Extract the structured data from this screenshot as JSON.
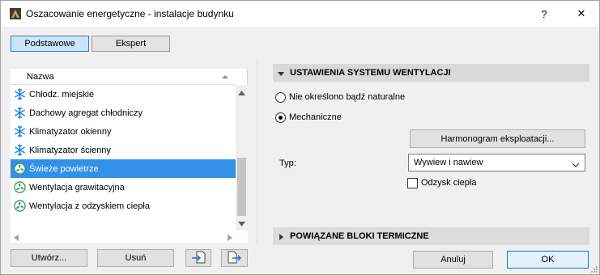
{
  "window": {
    "title": "Oszacowanie energetyczne - instalacje budynku",
    "help_label": "?",
    "close_label": "✕"
  },
  "tabs": [
    {
      "label": "Podstawowe",
      "active": true
    },
    {
      "label": "Ekspert",
      "active": false
    }
  ],
  "list": {
    "header": "Nazwa",
    "items": [
      {
        "label": "Chłodz. miejskie",
        "icon": "snowflake-icon",
        "selected": false
      },
      {
        "label": "Dachowy agregat chłodniczy",
        "icon": "snowflake-icon",
        "selected": false
      },
      {
        "label": "Klimatyzator okienny",
        "icon": "snowflake-icon",
        "selected": false
      },
      {
        "label": "Klimatyzator ścienny",
        "icon": "snowflake-icon",
        "selected": false
      },
      {
        "label": "Świeże powietrze",
        "icon": "fan-icon",
        "selected": true
      },
      {
        "label": "Wentylacja grawitacyjna",
        "icon": "fan-icon",
        "selected": false
      },
      {
        "label": "Wentylacja z odzyskiem ciepła",
        "icon": "fan-icon",
        "selected": false
      }
    ]
  },
  "buttons": {
    "create": "Utwórz...",
    "delete": "Usuń",
    "schedule": "Harmonogram eksploatacji...",
    "cancel": "Anuluj",
    "ok": "OK"
  },
  "ventilation": {
    "section_title": "USTAWIENIA SYSTEMU WENTYLACJI",
    "radio_none": "Nie określono bądź naturalne",
    "radio_mechanical": "Mechaniczne",
    "selected_option": "Mechaniczne",
    "type_label": "Typ:",
    "type_value": "Wywiew i nawiew",
    "heat_recovery_label": "Odzysk ciepła",
    "heat_recovery_checked": false
  },
  "thermal": {
    "section_title": "POWIĄZANE BLOKI TERMICZNE"
  },
  "colors": {
    "selection": "#3390e8",
    "snowflake": "#1e88e5",
    "fan": "#2e9e57",
    "ok_border": "#0078d7"
  }
}
